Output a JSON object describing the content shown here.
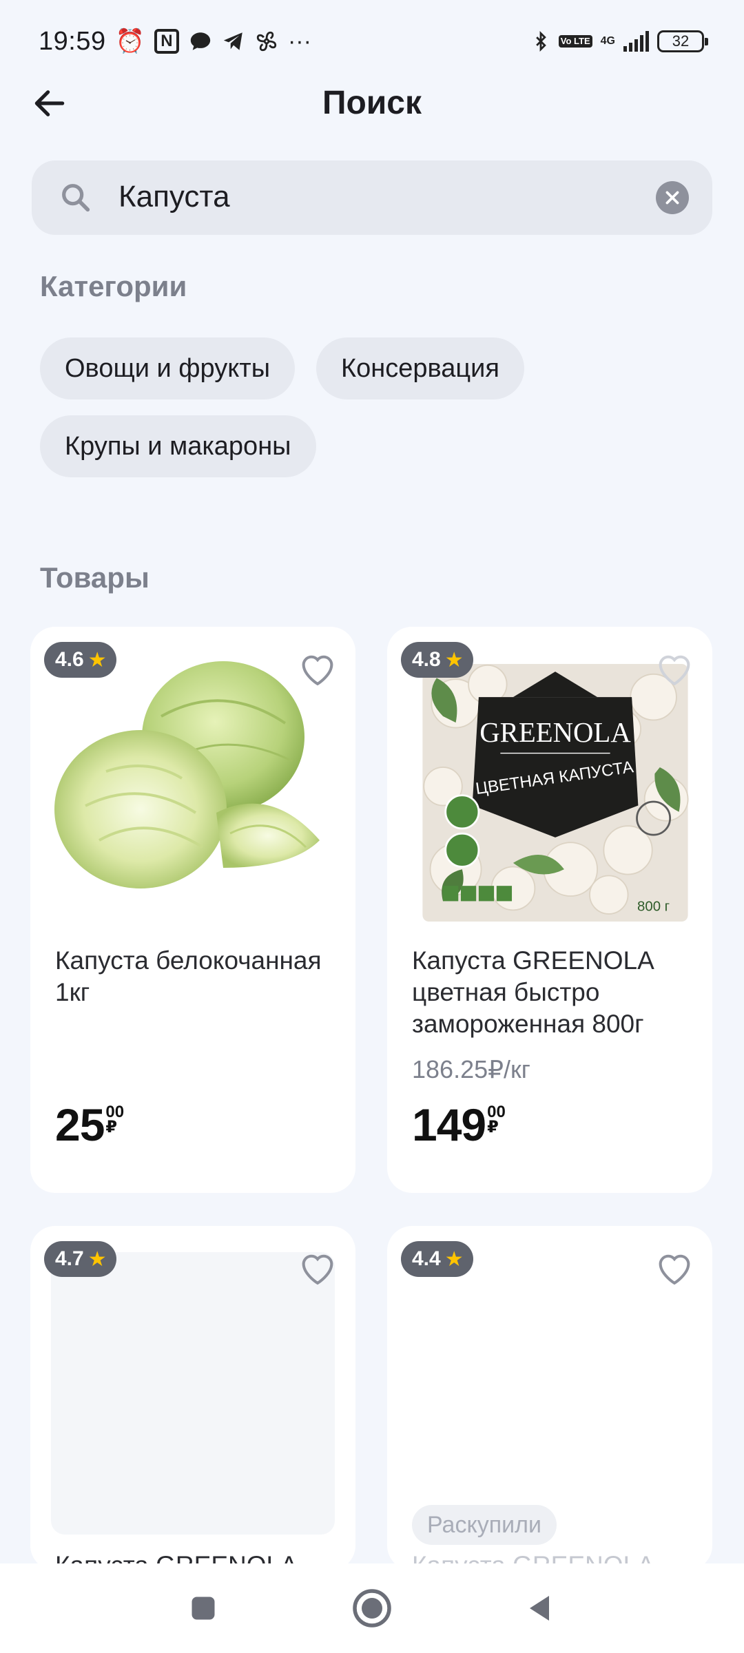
{
  "status_bar": {
    "time": "19:59",
    "network": "4G",
    "volte": "Vo LTE",
    "battery": "32"
  },
  "header": {
    "title": "Поиск",
    "back_icon": "arrow-left-icon"
  },
  "search": {
    "value": "Капуста",
    "search_icon": "search-icon",
    "clear_icon": "clear-icon"
  },
  "categories": {
    "title": "Категории",
    "items": [
      "Овощи и фрукты",
      "Консервация",
      "Крупы и макароны"
    ]
  },
  "products": {
    "title": "Товары",
    "items": [
      {
        "rating": "4.6",
        "name": "Капуста белокочанная 1кг",
        "unit_price": "",
        "price_int": "25",
        "price_dec": "00",
        "currency": "₽"
      },
      {
        "rating": "4.8",
        "name": "Капуста GREENOLA цветная быстро замороженная 800г",
        "unit_price": "186.25₽/кг",
        "price_int": "149",
        "price_dec": "00",
        "currency": "₽",
        "package_brand": "GREENOLA",
        "package_title": "ЦВЕТНАЯ КАПУСТА",
        "package_weight": "800 г"
      },
      {
        "rating": "4.7",
        "name": "Капуста GREENOLA"
      },
      {
        "rating": "4.4",
        "badge": "Раскупили",
        "name": "Капуста GREENOLA"
      }
    ]
  },
  "colors": {
    "background": "#f3f6fc",
    "card": "#ffffff",
    "rating_badge": "#5f636d",
    "star": "#ffc400",
    "chip": "#e6e9f0"
  }
}
